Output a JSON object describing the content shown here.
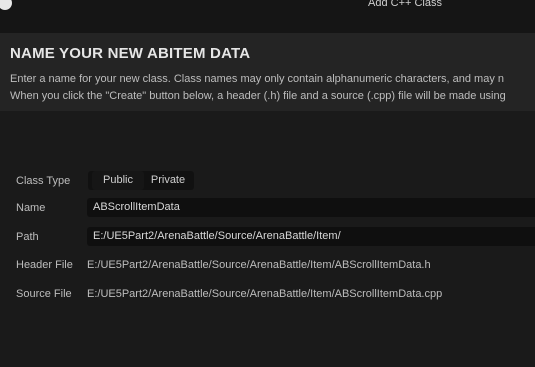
{
  "window": {
    "title": "Add C++ Class"
  },
  "header": {
    "title": "NAME YOUR NEW ABITEM DATA",
    "line1": "Enter a name for your new class. Class names may only contain alphanumeric characters, and may n",
    "line2": "When you click the \"Create\" button below, a header (.h) file and a source (.cpp) file will be made using"
  },
  "form": {
    "class_type_label": "Class Type",
    "class_type_options": [
      "Public",
      "Private"
    ],
    "name_label": "Name",
    "name_value": "ABScrollItemData",
    "path_label": "Path",
    "path_value": "E:/UE5Part2/ArenaBattle/Source/ArenaBattle/Item/",
    "header_file_label": "Header File",
    "header_file_value": "E:/UE5Part2/ArenaBattle/Source/ArenaBattle/Item/ABScrollItemData.h",
    "source_file_label": "Source File",
    "source_file_value": "E:/UE5Part2/ArenaBattle/Source/ArenaBattle/Item/ABScrollItemData.cpp"
  }
}
